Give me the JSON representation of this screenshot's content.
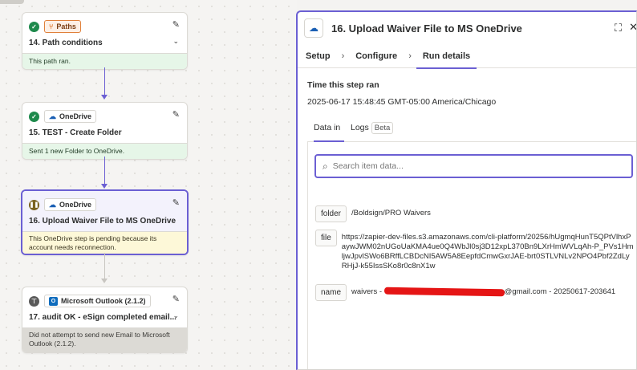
{
  "steps": [
    {
      "badge": "Paths",
      "title": "14. Path conditions",
      "footer": "This path ran."
    },
    {
      "badge": "OneDrive",
      "title": "15. TEST - Create Folder",
      "footer": "Sent 1 new Folder to OneDrive."
    },
    {
      "badge": "OneDrive",
      "title": "16. Upload Waiver File to MS OneDrive",
      "footer": "This OneDrive step is pending because its account needs reconnection."
    },
    {
      "badge": "Microsoft Outlook (2.1.2)",
      "title": "17. audit OK - eSign completed email...",
      "footer": "Did not attempt to send new Email to Microsoft Outlook (2.1.2)."
    }
  ],
  "panel": {
    "title": "16. Upload Waiver File to MS OneDrive",
    "tabs": [
      "Setup",
      "Configure",
      "Run details"
    ],
    "section_label": "Time this step ran",
    "timestamp": "2025-06-17 15:48:45 GMT-05:00 America/Chicago",
    "subtabs": {
      "data_in": "Data in",
      "logs": "Logs",
      "beta": "Beta"
    },
    "search_placeholder": "Search item data...",
    "fields": [
      {
        "key": "folder",
        "value": "/Boldsign/PRO Waivers"
      },
      {
        "key": "file",
        "value": "https://zapier-dev-files.s3.amazonaws.com/cli-platform/20256/hUgmqHunT5QPtVlhxPaywJWM02nUGoUaKMA4ue0Q4WbJl0sj3D12xpL370Bn9LXrHmWVLqAh-P_PVs1HmljwJpvlSWo6BRffLCBDcNI5AW5A8EepfdCmwGxrJAE-brt0STLVNLv2NPO4Pbf2ZdLyRHjJ-k55IssSKo8r0c8nX1w"
      },
      {
        "key": "name",
        "value_prefix": "waivers - ",
        "value_suffix": "@gmail.com - 20250617-203641"
      }
    ]
  }
}
